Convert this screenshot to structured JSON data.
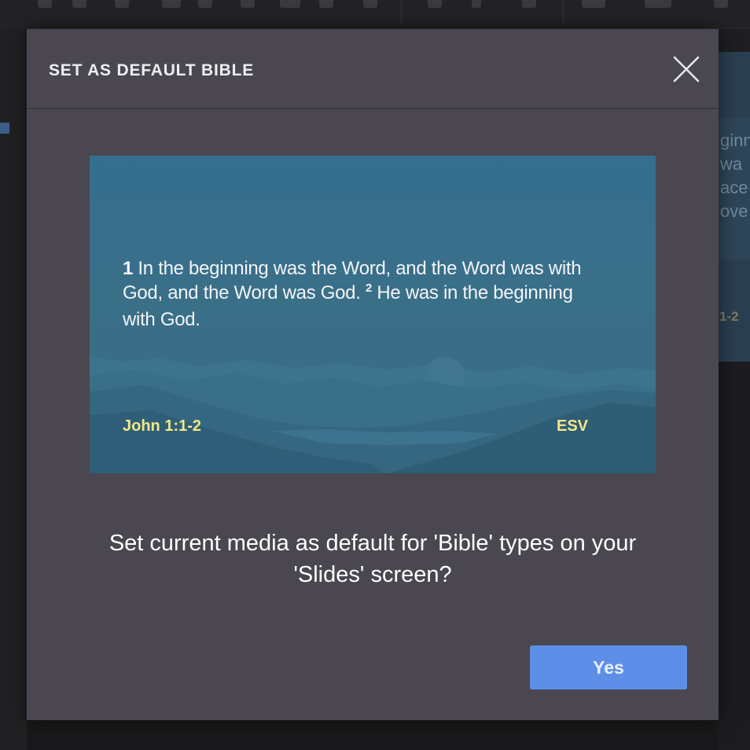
{
  "dialog": {
    "title": "SET AS DEFAULT BIBLE",
    "close_icon": "close-icon"
  },
  "preview": {
    "verse_1_number": "1",
    "verse_1_text": " In the beginning was the Word, and the Word was with God, and the Word was God. ",
    "verse_2_number": "2",
    "verse_2_text": " He was in the beginning with God.",
    "reference": "John 1:1-2",
    "version": "ESV",
    "text_color": "#f2f5f7",
    "accent_color": "#f3e58a",
    "background_color": "#356f8f"
  },
  "question": "Set current media as default for 'Bible' types on your 'Slides' screen?",
  "actions": {
    "yes_label": "Yes",
    "yes_color": "#5e8fe8"
  },
  "background": {
    "peek_lines": [
      "ginn",
      "wa",
      "ace",
      "ove"
    ],
    "peek_reference": "1-2"
  },
  "colors": {
    "dialog_bg": "#4a4750",
    "header_text": "#eeeef2"
  }
}
